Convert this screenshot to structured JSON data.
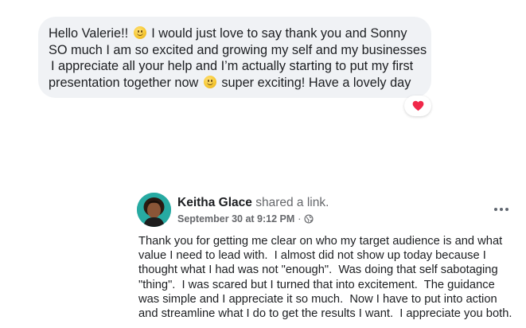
{
  "message": {
    "lines": [
      [
        "Hello Valerie!! ",
        " I would just love to say thank you and Sonny"
      ],
      [
        "SO much I am so excited and growing my self and my businesses"
      ],
      [
        "I appreciate all your help and I’m actually starting to put my first"
      ],
      [
        "presentation together now ",
        " super exciting! Have a lovely day"
      ]
    ],
    "emoji": "slightly-smiling-face-icon",
    "reaction": "heart-icon",
    "reaction_color": "#f02849",
    "bubble_color": "#f0f2f5"
  },
  "post": {
    "author": "Keitha Glace",
    "action": "shared a link.",
    "timestamp": "September 30 at 9:12 PM",
    "separator": "·",
    "privacy_icon": "globe-icon",
    "more_icon": "more-options-icon",
    "body_lines": [
      "Thank you for getting me clear on who my target audience is and what",
      "value I need to lead with.  I almost did not show up today because I",
      "thought what I had was not \"enough\".  Was doing that self sabotaging",
      "\"thing\".  I was scared but I turned that into excitement.  The guidance",
      "was simple and I appreciate it so much.  Now I have to put into action",
      "and streamline what I do to get the results I want.  I appreciate you both."
    ]
  }
}
